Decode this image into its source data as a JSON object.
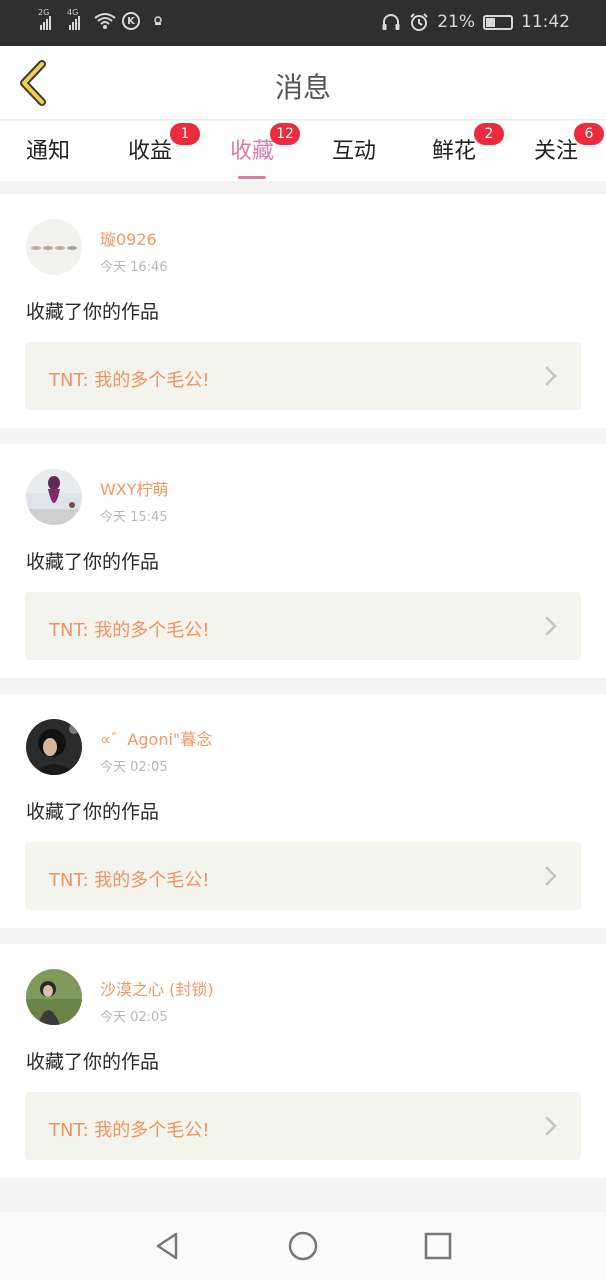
{
  "status_bar": {
    "net1": "2G",
    "net2": "4G",
    "k_icon": "K",
    "battery_pct": "21%",
    "time": "11:42"
  },
  "header": {
    "title": "消息"
  },
  "tabs": [
    {
      "label": "通知",
      "badge": ""
    },
    {
      "label": "收益",
      "badge": "1"
    },
    {
      "label": "收藏",
      "badge": "12",
      "active": true
    },
    {
      "label": "互动",
      "badge": ""
    },
    {
      "label": "鲜花",
      "badge": "2"
    },
    {
      "label": "关注",
      "badge": "6"
    }
  ],
  "items": [
    {
      "user": "璇0926",
      "time": "今天 16:46",
      "action": "收藏了你的作品",
      "work": "TNT: 我的多个毛公!"
    },
    {
      "user": "WXY柠萌",
      "time": "今天 15:45",
      "action": "收藏了你的作品",
      "work": "TNT: 我的多个毛公!"
    },
    {
      "user": "∝゛Agoni\"暮念",
      "time": "今天 02:05",
      "action": "收藏了你的作品",
      "work": "TNT: 我的多个毛公!"
    },
    {
      "user": "沙漠之心 (封锁)",
      "time": "今天 02:05",
      "action": "收藏了你的作品",
      "work": "TNT: 我的多个毛公!"
    }
  ],
  "colors": {
    "accent_pink": "#e27aa5",
    "name_orange": "#f09a64",
    "badge_red": "#ee2a3d",
    "back_yellow": "#f1d04a"
  },
  "icons": {
    "back": "chevron-left-icon",
    "nav_back": "triangle-back-icon",
    "nav_home": "circle-home-icon",
    "nav_recent": "square-recent-icon"
  }
}
